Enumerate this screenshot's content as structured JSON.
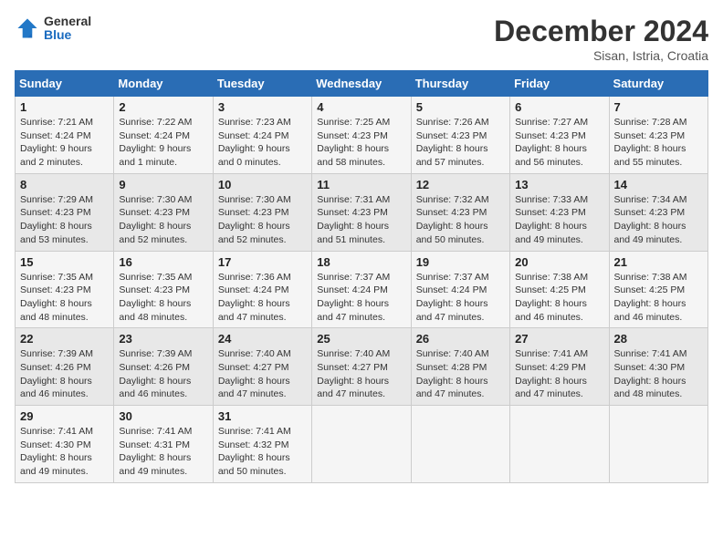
{
  "header": {
    "logo_general": "General",
    "logo_blue": "Blue",
    "month_title": "December 2024",
    "location": "Sisan, Istria, Croatia"
  },
  "weekdays": [
    "Sunday",
    "Monday",
    "Tuesday",
    "Wednesday",
    "Thursday",
    "Friday",
    "Saturday"
  ],
  "weeks": [
    [
      {
        "day": "1",
        "info": "Sunrise: 7:21 AM\nSunset: 4:24 PM\nDaylight: 9 hours and 2 minutes."
      },
      {
        "day": "2",
        "info": "Sunrise: 7:22 AM\nSunset: 4:24 PM\nDaylight: 9 hours and 1 minute."
      },
      {
        "day": "3",
        "info": "Sunrise: 7:23 AM\nSunset: 4:24 PM\nDaylight: 9 hours and 0 minutes."
      },
      {
        "day": "4",
        "info": "Sunrise: 7:25 AM\nSunset: 4:23 PM\nDaylight: 8 hours and 58 minutes."
      },
      {
        "day": "5",
        "info": "Sunrise: 7:26 AM\nSunset: 4:23 PM\nDaylight: 8 hours and 57 minutes."
      },
      {
        "day": "6",
        "info": "Sunrise: 7:27 AM\nSunset: 4:23 PM\nDaylight: 8 hours and 56 minutes."
      },
      {
        "day": "7",
        "info": "Sunrise: 7:28 AM\nSunset: 4:23 PM\nDaylight: 8 hours and 55 minutes."
      }
    ],
    [
      {
        "day": "8",
        "info": "Sunrise: 7:29 AM\nSunset: 4:23 PM\nDaylight: 8 hours and 53 minutes."
      },
      {
        "day": "9",
        "info": "Sunrise: 7:30 AM\nSunset: 4:23 PM\nDaylight: 8 hours and 52 minutes."
      },
      {
        "day": "10",
        "info": "Sunrise: 7:30 AM\nSunset: 4:23 PM\nDaylight: 8 hours and 52 minutes."
      },
      {
        "day": "11",
        "info": "Sunrise: 7:31 AM\nSunset: 4:23 PM\nDaylight: 8 hours and 51 minutes."
      },
      {
        "day": "12",
        "info": "Sunrise: 7:32 AM\nSunset: 4:23 PM\nDaylight: 8 hours and 50 minutes."
      },
      {
        "day": "13",
        "info": "Sunrise: 7:33 AM\nSunset: 4:23 PM\nDaylight: 8 hours and 49 minutes."
      },
      {
        "day": "14",
        "info": "Sunrise: 7:34 AM\nSunset: 4:23 PM\nDaylight: 8 hours and 49 minutes."
      }
    ],
    [
      {
        "day": "15",
        "info": "Sunrise: 7:35 AM\nSunset: 4:23 PM\nDaylight: 8 hours and 48 minutes."
      },
      {
        "day": "16",
        "info": "Sunrise: 7:35 AM\nSunset: 4:23 PM\nDaylight: 8 hours and 48 minutes."
      },
      {
        "day": "17",
        "info": "Sunrise: 7:36 AM\nSunset: 4:24 PM\nDaylight: 8 hours and 47 minutes."
      },
      {
        "day": "18",
        "info": "Sunrise: 7:37 AM\nSunset: 4:24 PM\nDaylight: 8 hours and 47 minutes."
      },
      {
        "day": "19",
        "info": "Sunrise: 7:37 AM\nSunset: 4:24 PM\nDaylight: 8 hours and 47 minutes."
      },
      {
        "day": "20",
        "info": "Sunrise: 7:38 AM\nSunset: 4:25 PM\nDaylight: 8 hours and 46 minutes."
      },
      {
        "day": "21",
        "info": "Sunrise: 7:38 AM\nSunset: 4:25 PM\nDaylight: 8 hours and 46 minutes."
      }
    ],
    [
      {
        "day": "22",
        "info": "Sunrise: 7:39 AM\nSunset: 4:26 PM\nDaylight: 8 hours and 46 minutes."
      },
      {
        "day": "23",
        "info": "Sunrise: 7:39 AM\nSunset: 4:26 PM\nDaylight: 8 hours and 46 minutes."
      },
      {
        "day": "24",
        "info": "Sunrise: 7:40 AM\nSunset: 4:27 PM\nDaylight: 8 hours and 47 minutes."
      },
      {
        "day": "25",
        "info": "Sunrise: 7:40 AM\nSunset: 4:27 PM\nDaylight: 8 hours and 47 minutes."
      },
      {
        "day": "26",
        "info": "Sunrise: 7:40 AM\nSunset: 4:28 PM\nDaylight: 8 hours and 47 minutes."
      },
      {
        "day": "27",
        "info": "Sunrise: 7:41 AM\nSunset: 4:29 PM\nDaylight: 8 hours and 47 minutes."
      },
      {
        "day": "28",
        "info": "Sunrise: 7:41 AM\nSunset: 4:30 PM\nDaylight: 8 hours and 48 minutes."
      }
    ],
    [
      {
        "day": "29",
        "info": "Sunrise: 7:41 AM\nSunset: 4:30 PM\nDaylight: 8 hours and 49 minutes."
      },
      {
        "day": "30",
        "info": "Sunrise: 7:41 AM\nSunset: 4:31 PM\nDaylight: 8 hours and 49 minutes."
      },
      {
        "day": "31",
        "info": "Sunrise: 7:41 AM\nSunset: 4:32 PM\nDaylight: 8 hours and 50 minutes."
      },
      {
        "day": "",
        "info": ""
      },
      {
        "day": "",
        "info": ""
      },
      {
        "day": "",
        "info": ""
      },
      {
        "day": "",
        "info": ""
      }
    ]
  ]
}
